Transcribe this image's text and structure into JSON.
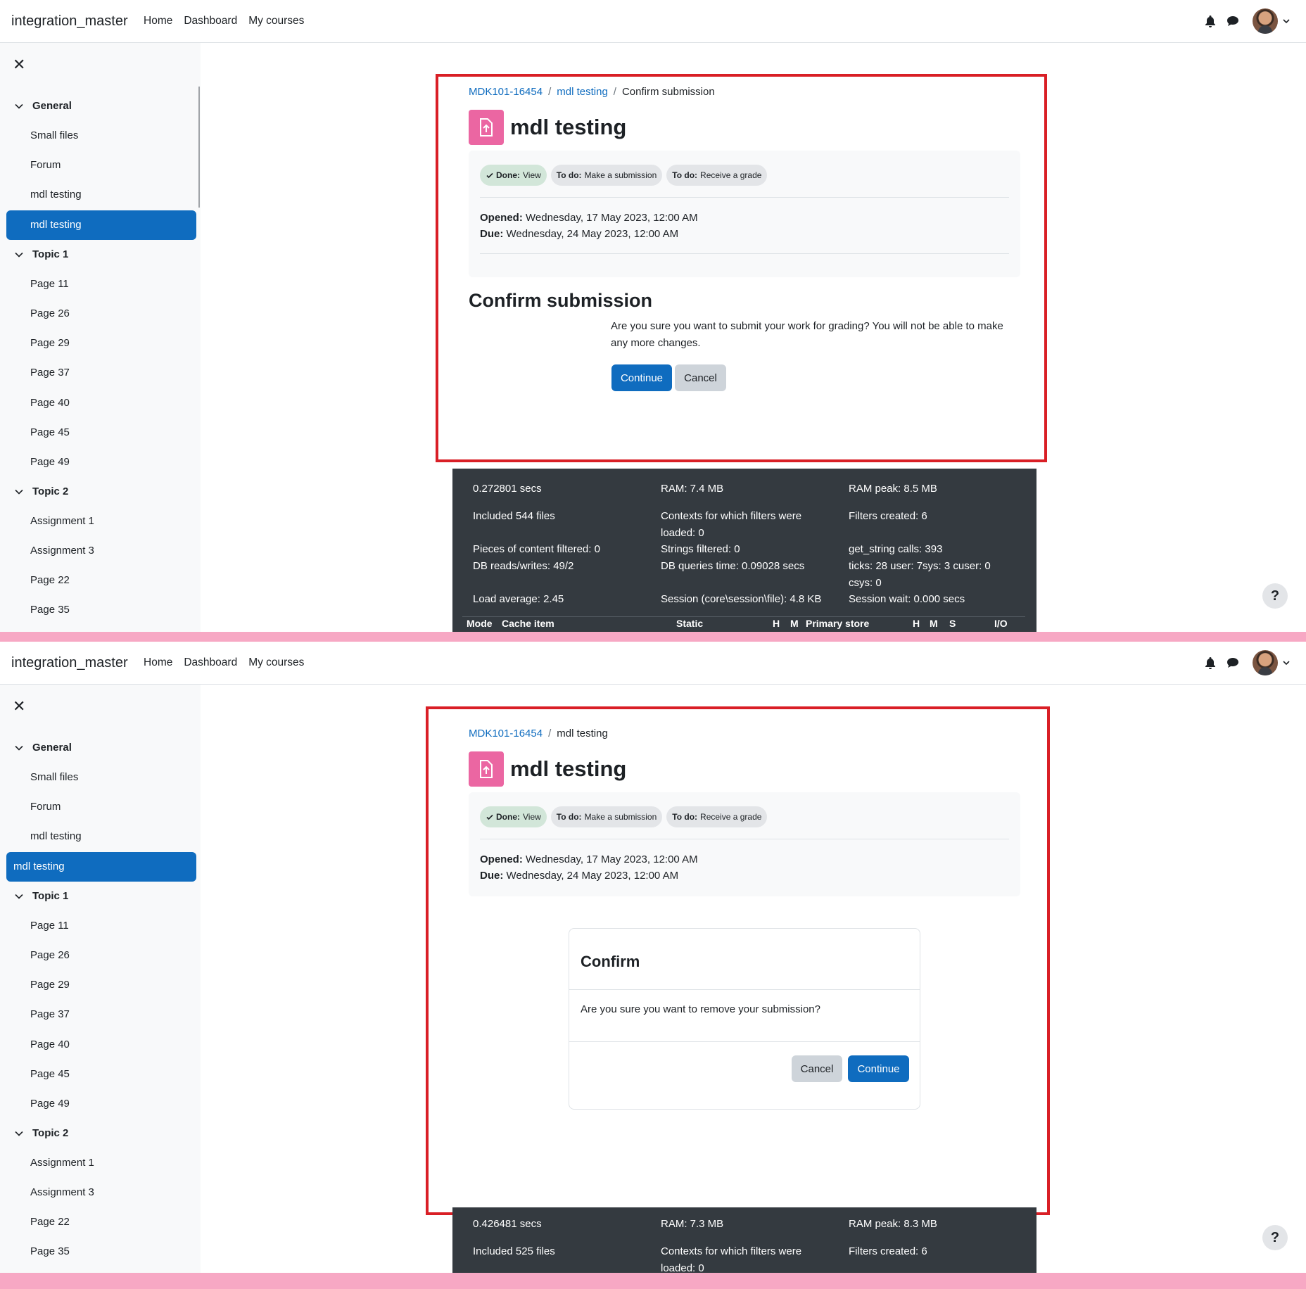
{
  "navbar": {
    "brand": "integration_master",
    "links": [
      "Home",
      "Dashboard",
      "My courses"
    ]
  },
  "icons": {
    "bell": "bell-icon",
    "messages": "chat-icon",
    "user": "avatar",
    "menu": "chevron-down-icon",
    "close": "close-icon",
    "help": "help-icon"
  },
  "drawer": {
    "sections": [
      {
        "title": "General",
        "items": [
          "Small files",
          "Forum",
          "mdl testing",
          "mdl testing"
        ]
      },
      {
        "title": "Topic 1",
        "items": [
          "Page 11",
          "Page 26",
          "Page 29",
          "Page 37",
          "Page 40",
          "Page 45",
          "Page 49"
        ]
      },
      {
        "title": "Topic 2",
        "items": [
          "Assignment 1",
          "Assignment 3",
          "Page 22",
          "Page 35"
        ]
      }
    ],
    "active_item": "mdl testing"
  },
  "panel1": {
    "breadcrumb": [
      "MDK101-16454",
      "mdl testing",
      "Confirm submission"
    ],
    "title": "mdl testing",
    "badges": [
      {
        "label": "Done:",
        "text": "View",
        "state": "done"
      },
      {
        "label": "To do:",
        "text": "Make a submission",
        "state": "todo"
      },
      {
        "label": "To do:",
        "text": "Receive a grade",
        "state": "todo"
      }
    ],
    "opened_label": "Opened:",
    "opened": "Wednesday, 17 May 2023, 12:00 AM",
    "due_label": "Due:",
    "due": "Wednesday, 24 May 2023, 12:00 AM",
    "heading": "Confirm submission",
    "question": "Are you sure you want to submit your work for grading? You will not be able to make any more changes.",
    "continue": "Continue",
    "cancel": "Cancel",
    "perf": {
      "time": "0.272801 secs",
      "ram": "RAM: 7.4 MB",
      "ram_peak": "RAM peak: 8.5 MB",
      "included": "Included 544 files",
      "contexts": "Contexts for which filters were loaded: 0",
      "filters": "Filters created: 6",
      "pieces": "Pieces of content filtered: 0",
      "strings": "Strings filtered: 0",
      "get_string": "get_string calls: 393",
      "db": "DB reads/writes: 49/2",
      "dbtime": "DB queries time: 0.09028 secs",
      "ticks": "ticks: 28 user: 7sys: 3 cuser: 0 csys: 0",
      "load": "Load average: 2.45",
      "session": "Session (core\\session\\file): 4.8 KB",
      "wait": "Session wait: 0.000 secs",
      "table_headers": [
        "Mode",
        "Cache item",
        "Static",
        "H",
        "M",
        "Primary store",
        "H",
        "M",
        "S",
        "I/O"
      ]
    }
  },
  "panel2": {
    "breadcrumb": [
      "MDK101-16454",
      "mdl testing"
    ],
    "title": "mdl testing",
    "opened_label": "Opened:",
    "opened": "Wednesday, 17 May 2023, 12:00 AM",
    "due_label": "Due:",
    "due": "Wednesday, 24 May 2023, 12:00 AM",
    "modal": {
      "title": "Confirm",
      "body": "Are you sure you want to remove your submission?",
      "cancel": "Cancel",
      "continue": "Continue"
    },
    "perf": {
      "time": "0.426481 secs",
      "ram": "RAM: 7.3 MB",
      "ram_peak": "RAM peak: 8.3 MB",
      "included": "Included 525 files",
      "contexts": "Contexts for which filters were loaded: 0",
      "filters": "Filters created: 6"
    }
  },
  "help": "?"
}
